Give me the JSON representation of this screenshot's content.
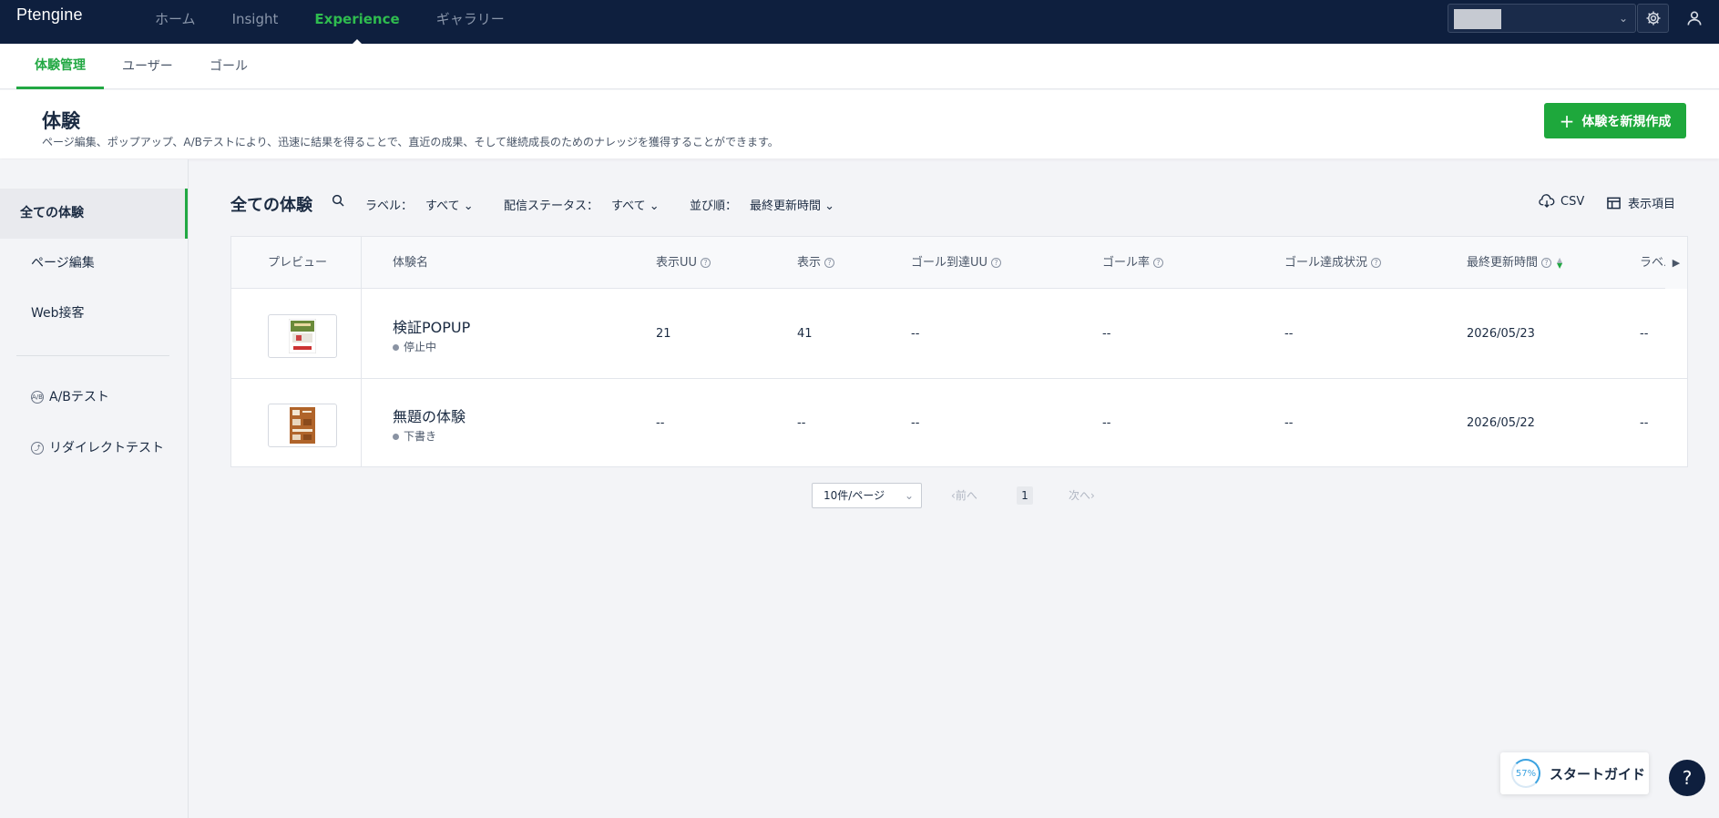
{
  "app": {
    "logo": "Ptengine"
  },
  "nav": {
    "items": [
      {
        "label": "ホーム"
      },
      {
        "label": "Insight"
      },
      {
        "label": "Experience"
      },
      {
        "label": "ギャラリー"
      }
    ]
  },
  "subtabs": [
    {
      "label": "体験管理"
    },
    {
      "label": "ユーザー"
    },
    {
      "label": "ゴール"
    }
  ],
  "header": {
    "title": "体験",
    "description": "ページ編集、ポップアップ、A/Bテストにより、迅速に結果を得ることで、直近の成果、そして継続成長のためのナレッジを獲得することができます。",
    "create_button": "体験を新規作成"
  },
  "sidebar": {
    "items": [
      {
        "label": "全ての体験"
      },
      {
        "label": "ページ編集"
      },
      {
        "label": "Web接客"
      },
      {
        "label": "A/Bテスト",
        "icon": "ab-icon"
      },
      {
        "label": "リダイレクトテスト",
        "icon": "redirect-icon"
      }
    ]
  },
  "toolbar": {
    "title": "全ての体験",
    "label_filter": {
      "label": "ラベル：",
      "value": "すべて"
    },
    "status_filter": {
      "label": "配信ステータス：",
      "value": "すべて"
    },
    "sort": {
      "label": "並び順：",
      "value": "最終更新時間"
    },
    "csv": "CSV",
    "columns": "表示項目"
  },
  "table": {
    "headers": [
      "プレビュー",
      "体験名",
      "表示UU",
      "表示",
      "ゴール到達UU",
      "ゴール率",
      "ゴール達成状況",
      "最終更新時間",
      "ラベル"
    ],
    "rows": [
      {
        "name": "検証POPUP",
        "status": "停止中",
        "uu": "21",
        "views": "41",
        "goal_uu": "--",
        "goal_rate": "--",
        "goal_status": "--",
        "updated": "2026/05/23",
        "label": "--"
      },
      {
        "name": "無題の体験",
        "status": "下書き",
        "uu": "--",
        "views": "--",
        "goal_uu": "--",
        "goal_rate": "--",
        "goal_status": "--",
        "updated": "2026/05/22",
        "label": "--"
      }
    ]
  },
  "pager": {
    "page_size": "10件/ページ",
    "prev": "前へ",
    "current": "1",
    "next": "次へ"
  },
  "guide": {
    "progress": "57%",
    "label": "スタートガイド"
  },
  "help": {
    "label": "?"
  },
  "colors": {
    "nav_bg": "#0e1f3e",
    "accent": "#22a843",
    "button": "#1ea83c"
  }
}
